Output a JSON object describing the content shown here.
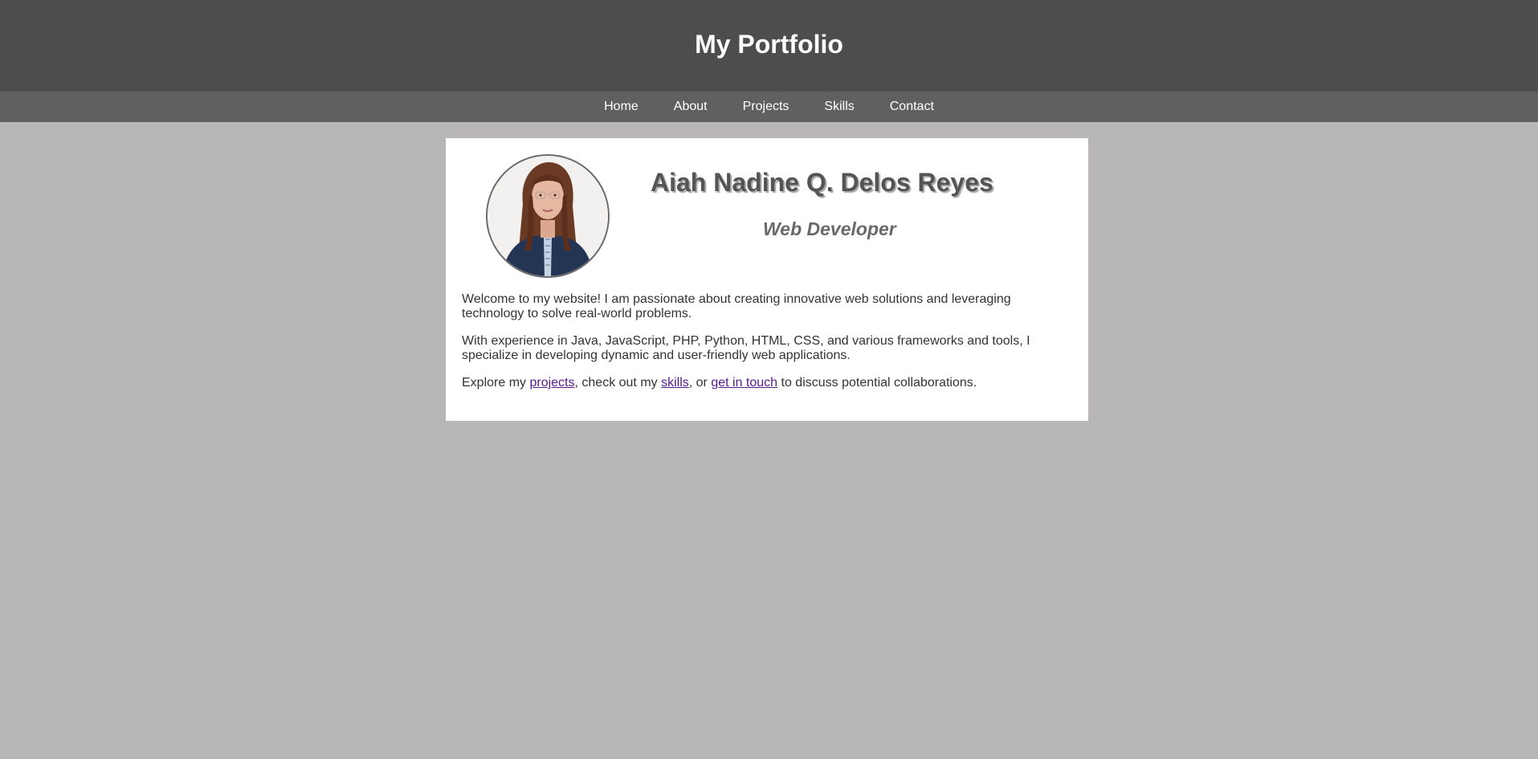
{
  "header": {
    "title": "My Portfolio"
  },
  "nav": {
    "items": [
      {
        "label": "Home"
      },
      {
        "label": "About"
      },
      {
        "label": "Projects"
      },
      {
        "label": "Skills"
      },
      {
        "label": "Contact"
      }
    ]
  },
  "profile": {
    "name": "Aiah Nadine Q. Delos Reyes",
    "role": "Web Developer",
    "avatar_icon": "profile-photo"
  },
  "bio": {
    "paragraph1": "Welcome to my website! I am passionate about creating innovative web solutions and leveraging technology to solve real-world problems.",
    "paragraph2": "With experience in Java, JavaScript, PHP, Python, HTML, CSS, and various frameworks and tools, I specialize in developing dynamic and user-friendly web applications.",
    "paragraph3_prefix": "Explore my ",
    "projects_link": "projects",
    "paragraph3_mid1": ", check out my ",
    "skills_link": "skills",
    "paragraph3_mid2": ", or ",
    "contact_link": "get in touch",
    "paragraph3_suffix": " to discuss potential collaborations."
  },
  "colors": {
    "header_bg": "#4e4c4d",
    "nav_bg": "#615f60",
    "page_bg": "#b8b6b7",
    "card_bg": "#ffffff",
    "link": "#551a8b"
  }
}
